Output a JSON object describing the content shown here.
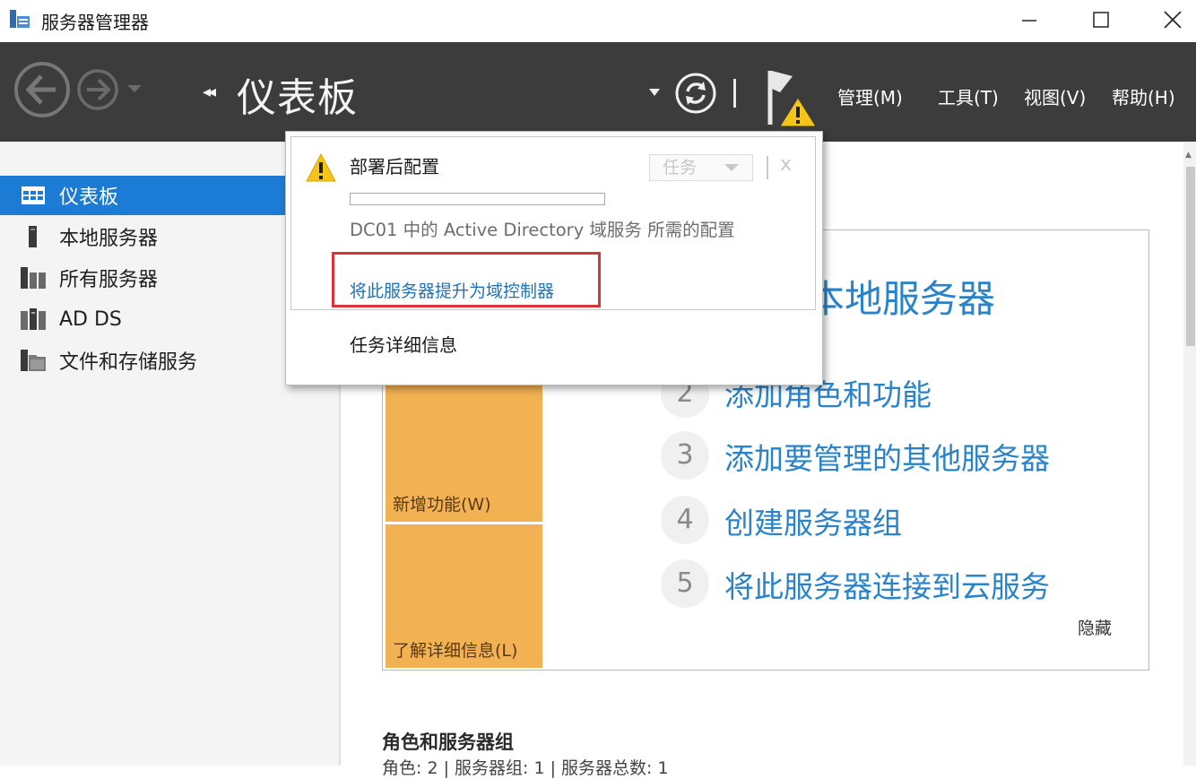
{
  "window": {
    "title": "服务器管理器",
    "controls": {
      "minimize": "minimize-icon",
      "maximize": "maximize-icon",
      "close": "close-icon"
    }
  },
  "header": {
    "breadcrumb_arrows": "◂◂",
    "title": "仪表板",
    "menu": [
      "管理(M)",
      "工具(T)",
      "视图(V)",
      "帮助(H)"
    ]
  },
  "sidebar": {
    "items": [
      {
        "label": "仪表板",
        "icon": "dashboard-grid-icon",
        "active": true
      },
      {
        "label": "本地服务器",
        "icon": "server-icon",
        "active": false
      },
      {
        "label": "所有服务器",
        "icon": "servers-icon",
        "active": false
      },
      {
        "label": "AD DS",
        "icon": "ad-ds-icon",
        "active": false
      },
      {
        "label": "文件和存储服务",
        "icon": "file-storage-icon",
        "active": false
      }
    ]
  },
  "quick_start": {
    "tiles": [
      "新增功能(W)",
      "了解详细信息(L)"
    ],
    "heading_partial": "本地服务器",
    "steps": [
      {
        "num": "2",
        "text": "添加角色和功能"
      },
      {
        "num": "3",
        "text": "添加要管理的其他服务器"
      },
      {
        "num": "4",
        "text": "创建服务器组"
      },
      {
        "num": "5",
        "text": "将此服务器连接到云服务"
      }
    ],
    "hide": "隐藏"
  },
  "roles": {
    "title": "角色和服务器组",
    "subtitle": "角色: 2 | 服务器组: 1 | 服务器总数: 1"
  },
  "notification": {
    "title": "部署后配置",
    "task_button": "任务",
    "close": "x",
    "progress": 0,
    "description": "DC01 中的 Active Directory 域服务 所需的配置",
    "action_link": "将此服务器提升为域控制器",
    "details_link": "任务详细信息"
  },
  "colors": {
    "header_bg": "#3c3c3c",
    "sidebar_active": "#1c7bd4",
    "tile_orange": "#f2b152",
    "link_blue": "#2a83c9",
    "highlight_red": "#d9333a"
  }
}
